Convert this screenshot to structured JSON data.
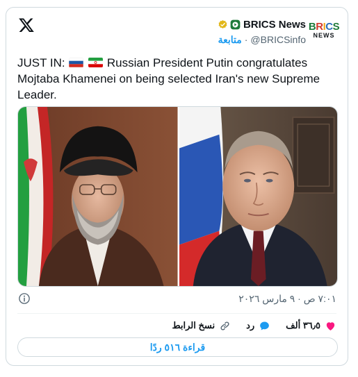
{
  "author": {
    "display_name": "BRICS News",
    "handle": "@BRICSinfo",
    "separator": "·",
    "follow_label": "متابعة",
    "avatar_top": [
      "B",
      "R",
      "I",
      "C",
      "S"
    ],
    "avatar_bottom": "NEWS"
  },
  "tweet": {
    "prefix": "JUST IN:",
    "body": " Russian President Putin congratulates Mojtaba Khamenei on being selected Iran's new Supreme Leader.",
    "flags": [
      "russia-flag",
      "iran-flag"
    ]
  },
  "timestamp": "٧:٠١ ص · ٩ مارس ٢٠٢٦",
  "actions": {
    "like_count": "٣٦٫٥ ألف",
    "reply_label": "رد",
    "copy_link_label": "نسخ الرابط"
  },
  "read_replies_label": "قراءة ٥١٦ ردًا",
  "colors": {
    "accent": "#1d9bf0",
    "like": "#f91880",
    "muted": "#536471",
    "border": "#cfd9de"
  },
  "icons": [
    "x-logo-icon",
    "verified-badge-icon",
    "subscription-badge-icon",
    "info-icon",
    "heart-icon",
    "reply-icon",
    "link-icon"
  ]
}
